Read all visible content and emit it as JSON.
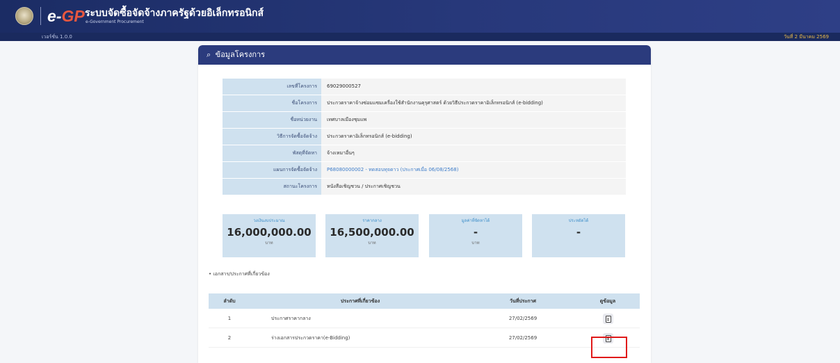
{
  "header": {
    "logo_e": "e-",
    "logo_gp": "GP",
    "title": "ระบบจัดซื้อจัดจ้างภาครัฐด้วยอิเล็กทรอนิกส์",
    "subtitle": "e-Government Procurement",
    "version": "เวอร์ชั่น 1.0.0",
    "date": "วันที่ 2 มีนาคม 2569"
  },
  "card": {
    "title": "ข้อมูลโครงการ",
    "search_icon": "magnifier-icon"
  },
  "project": {
    "rows": [
      {
        "label": "เลขที่โครงการ",
        "value": "69029000527"
      },
      {
        "label": "ชื่อโครงการ",
        "value": "ประกวดราคาจ้างซ่อมแซมเครื่องใช้สำนักงานคุรุศาสตร์ ด้วยวิธีประกวดราคาอิเล็กทรอนิกส์ (e-bidding)"
      },
      {
        "label": "ชื่อหน่วยงาน",
        "value": "เทศบาลเมืองชุมแพ"
      },
      {
        "label": "วิธีการจัดซื้อจัดจ้าง",
        "value": "ประกวดราคาอิเล็กทรอนิกส์ (e-bidding)"
      },
      {
        "label": "พัสดุที่จัดหา",
        "value": "จ้างเหมาอื่นๆ"
      },
      {
        "label": "แผนการจัดซื้อจัดจ้าง",
        "value": "P68080000002 - ทดสอบทุจดาว (ประกาศเมื่อ 06/08/2568)"
      },
      {
        "label": "สถานะโครงการ",
        "value": "หนังสือเชิญชวน / ประกาศเชิญชวน"
      }
    ]
  },
  "stats": [
    {
      "label": "วงเงินงบประมาณ",
      "value": "16,000,000.00",
      "unit": "บาท"
    },
    {
      "label": "ราคากลาง",
      "value": "16,500,000.00",
      "unit": "บาท"
    },
    {
      "label": "มูลค่าที่จัดหาได้",
      "value": "-",
      "unit": "บาท"
    },
    {
      "label": "ประหยัดได้",
      "value": "-",
      "unit": ""
    }
  ],
  "docs": {
    "section_title": "• เอกสาร/ประกาศที่เกี่ยวข้อง",
    "columns": [
      "ลำดับ",
      "ประกาศที่เกี่ยวข้อง",
      "วันที่ประกาศ",
      "ดูข้อมูล"
    ],
    "rows": [
      {
        "no": "1",
        "title": "ประกาศราคากลาง",
        "date": "27/02/2569",
        "icon": "document-icon"
      },
      {
        "no": "2",
        "title": "ร่างเอกสารประกวดราคา(e-Bidding)",
        "date": "27/02/2569",
        "icon": "document-icon"
      }
    ]
  },
  "colors": {
    "header_navy": "#1b2c64",
    "card_header": "#2b3b7d",
    "label_bg": "#cfe1ef",
    "link": "#3d7cc9",
    "highlight": "#e01919"
  }
}
